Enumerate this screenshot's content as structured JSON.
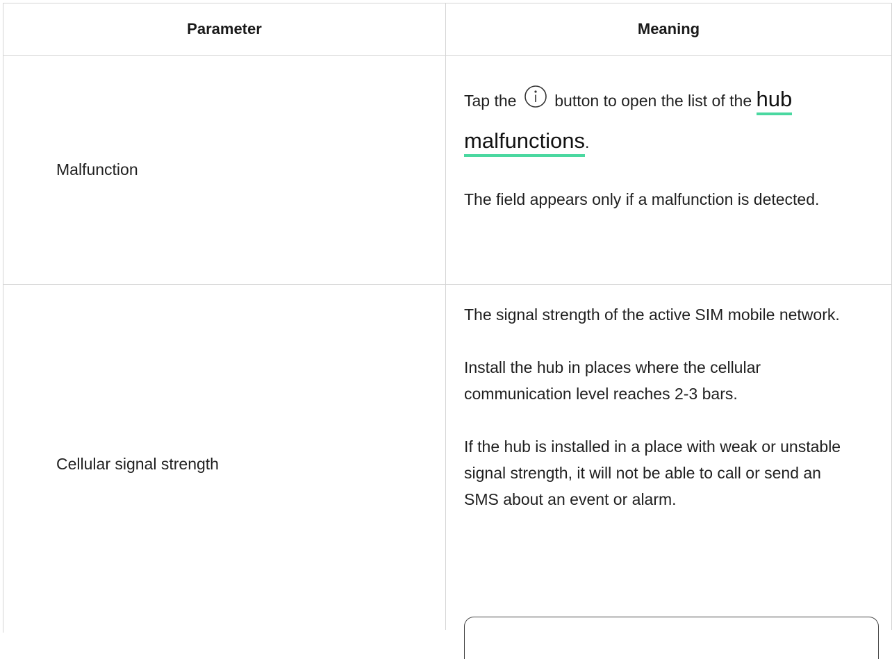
{
  "table": {
    "headers": {
      "parameter": "Parameter",
      "meaning": "Meaning"
    },
    "rows": [
      {
        "parameter": "Malfunction",
        "meaning": {
          "tap_prefix": "Tap the",
          "icon": "info-circle-icon",
          "tap_suffix": "button to open the list of the",
          "link_text": "hub malfunctions",
          "after_link": ".",
          "note": "The field appears only if a malfunction is detected."
        }
      },
      {
        "parameter": "Cellular signal strength",
        "meaning": {
          "paragraphs": [
            "The signal strength of the active SIM mobile network.",
            "Install the hub in places where the cellular communication level reaches 2-3 bars.",
            "If the hub is installed in a place with weak or unstable signal strength, it will not be able to call or send an SMS about an event or alarm."
          ]
        }
      }
    ]
  },
  "colors": {
    "border": "#d4d4d4",
    "link_underline": "#4ad8a0",
    "text": "#1f1f1f"
  }
}
